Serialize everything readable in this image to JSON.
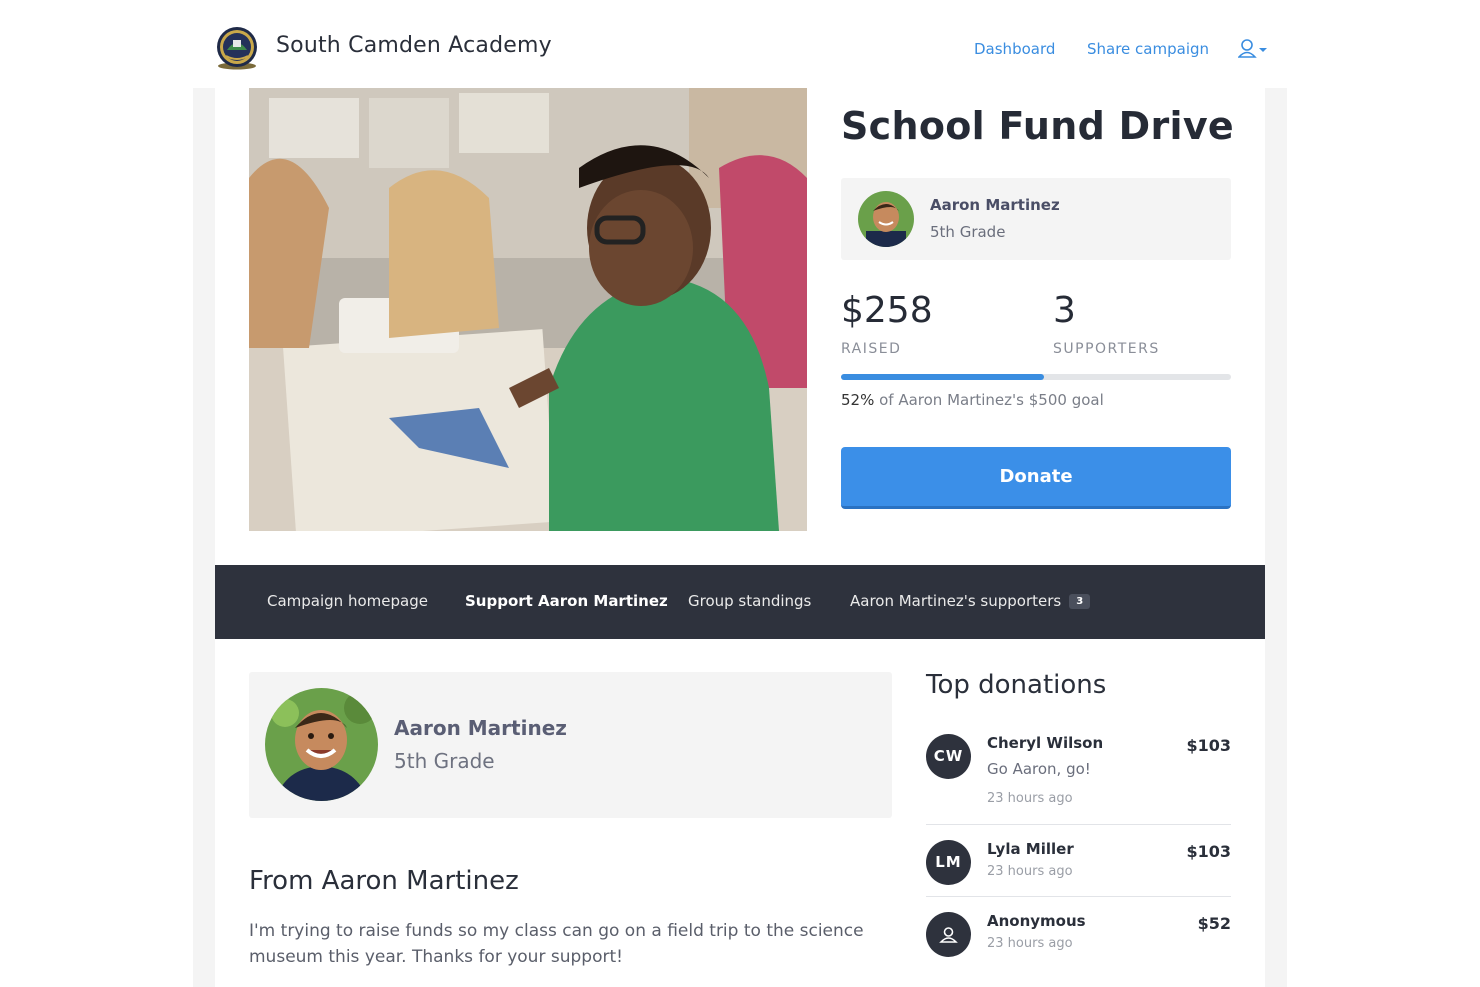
{
  "header": {
    "school_name": "South Camden Academy",
    "nav": {
      "dashboard": "Dashboard",
      "share": "Share campaign"
    }
  },
  "campaign": {
    "title": "School Fund Drive",
    "student": {
      "name": "Aaron Martinez",
      "grade": "5th Grade"
    },
    "raised_value": "$258",
    "raised_label": "RAISED",
    "supporters_value": "3",
    "supporters_label": "SUPPORTERS",
    "progress_fraction": 0.52,
    "goal_percent": "52%",
    "goal_text": " of Aaron Martinez's $500 goal",
    "donate_label": "Donate"
  },
  "tabs": {
    "home": "Campaign homepage",
    "support": "Support Aaron Martinez",
    "standings": "Group standings",
    "supporters": "Aaron Martinez's supporters",
    "supporters_count": "3"
  },
  "profile": {
    "name": "Aaron Martinez",
    "grade": "5th Grade",
    "from_heading": "From Aaron Martinez",
    "message": "I'm trying to raise funds so my class can go on a field trip to the science museum this year. Thanks for your support!"
  },
  "donations": {
    "title": "Top donations",
    "items": [
      {
        "initials": "CW",
        "name": "Cheryl Wilson",
        "amount": "$103",
        "note": "Go Aaron, go!",
        "time": "23 hours ago"
      },
      {
        "initials": "LM",
        "name": "Lyla Miller",
        "amount": "$103",
        "time": "23 hours ago"
      },
      {
        "name": "Anonymous",
        "amount": "$52",
        "time": "23 hours ago"
      }
    ]
  },
  "colors": {
    "accent": "#3b8fe8",
    "dark": "#2e323d",
    "card": "#f4f4f4"
  },
  "icons": {
    "user_menu": "user-icon",
    "anonymous": "user-icon"
  }
}
